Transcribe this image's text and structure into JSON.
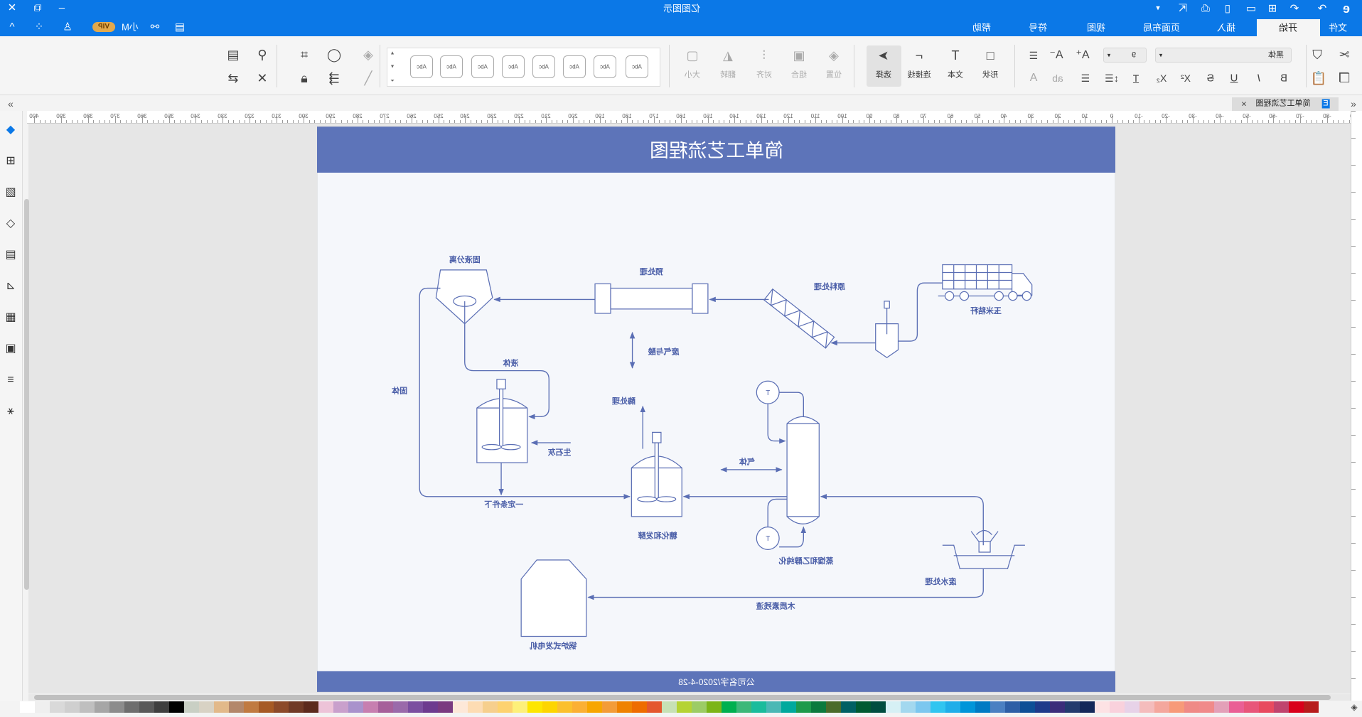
{
  "app": {
    "title": "亿图图示"
  },
  "titlebar": {
    "close_icon": "✕",
    "restore_icon": "⧉",
    "minimize_icon": "–",
    "logo_icon": "e-logo",
    "icons": [
      "redo-icon",
      "undo-icon",
      "new-icon",
      "open-icon",
      "save-icon",
      "print-icon",
      "export-icon",
      "more-icon"
    ]
  },
  "account": {
    "vip": "VIP",
    "user": "小M"
  },
  "menu_tabs": [
    {
      "label": "文件"
    },
    {
      "label": "开始"
    },
    {
      "label": "插入"
    },
    {
      "label": "页面布局"
    },
    {
      "label": "视图"
    },
    {
      "label": "符号"
    },
    {
      "label": "帮助"
    }
  ],
  "ribbon": {
    "font_name": "黑体",
    "font_size": "9",
    "tools": [
      {
        "label": "形状",
        "icon": "□"
      },
      {
        "label": "文本",
        "icon": "T"
      },
      {
        "label": "连接线",
        "icon": "⌐"
      },
      {
        "label": "选择",
        "icon": "➤"
      }
    ],
    "arrange": [
      {
        "label": "位置",
        "icon": "◈"
      },
      {
        "label": "组合",
        "icon": "▣"
      },
      {
        "label": "对齐",
        "icon": "⫶"
      },
      {
        "label": "翻转",
        "icon": "◭"
      },
      {
        "label": "大小",
        "icon": "▢"
      }
    ],
    "style_sample": "Abc"
  },
  "document_tab": {
    "title": "简单工艺流程图",
    "close": "×"
  },
  "ruler": {
    "labels": [
      400,
      390,
      380,
      370,
      360,
      350,
      340,
      330,
      320,
      310,
      300,
      290,
      280,
      270,
      260,
      250,
      240,
      230,
      220,
      210,
      200,
      190,
      180,
      170,
      160,
      150,
      140,
      130,
      120,
      110,
      100,
      90,
      80,
      70,
      60,
      50,
      40,
      30,
      20,
      10,
      0,
      -10,
      -20,
      -30,
      -40,
      -50,
      -60,
      -70,
      -80,
      -90
    ]
  },
  "diagram": {
    "title": "简单工艺流程图",
    "footer": "公司名字/2020-4-28",
    "colors": {
      "header": "#5d74b9",
      "line": "#5a6eb4",
      "text": "#4a5ea8",
      "page": "#f5f7fb"
    },
    "labels": {
      "separation": "固液分离",
      "pretreatment": "预处理",
      "raw_processing": "原料处理",
      "corn_stalk": "玉米秸秆",
      "waste_gas_acid": "废气与酸",
      "liquid": "液体",
      "solid": "固体",
      "quicklime": "生石灰",
      "conditions": "一定条件下",
      "enzyme": "酶处理",
      "saccharification": "糖化和发酵",
      "gas": "气体",
      "distillation": "蒸馏和乙醇纯化",
      "wastewater": "废水处理",
      "lignin": "木质素残渣",
      "boiler": "锅炉式发电机",
      "t1": "T",
      "t2": "T"
    }
  },
  "palette": [
    "#ffffff",
    "#efefef",
    "#d9d9d9",
    "#cfcfcf",
    "#bfbfbf",
    "#a6a6a6",
    "#8c8c8c",
    "#6e6e6e",
    "#595959",
    "#3f3f3f",
    "#000000",
    "#c9cfc4",
    "#d8d2c4",
    "#e2b98a",
    "#b3876a",
    "#c07a41",
    "#a65a25",
    "#8c4a2a",
    "#703a26",
    "#5c2a1d",
    "#edc3d8",
    "#c9a0cc",
    "#a992cc",
    "#c77fb0",
    "#a6609a",
    "#9a6aaa",
    "#7b4fa0",
    "#6d3b8f",
    "#7a3a80",
    "#fde8d8",
    "#fddcb3",
    "#f6cf8d",
    "#fdd26f",
    "#fdf07a",
    "#fde600",
    "#fdd500",
    "#fbc02d",
    "#fbb034",
    "#f7a600",
    "#f39c38",
    "#ef8200",
    "#ee6c00",
    "#e4572e",
    "#c7e1b5",
    "#b5d334",
    "#9ccc65",
    "#7cb518",
    "#00b050",
    "#3cb879",
    "#1abc9c",
    "#4ab8b5",
    "#00a99d",
    "#1d9a4b",
    "#0b7a3e",
    "#4a6b2a",
    "#006064",
    "#005a32",
    "#004d40",
    "#d6f0f5",
    "#a3d8ef",
    "#7cc7ef",
    "#30c5f0",
    "#1faee9",
    "#0095d9",
    "#007ac3",
    "#4b80c2",
    "#2e5fa6",
    "#0d4f96",
    "#1e3a8a",
    "#3b2d7a",
    "#233b6e",
    "#14285a",
    "#fde2e4",
    "#f9d1dc",
    "#e7d2e8",
    "#f4bcbc",
    "#f4a79d",
    "#f79a79",
    "#ef8a86",
    "#f08a8a",
    "#e3a0b8",
    "#ea5f95",
    "#e8567a",
    "#e84a5f",
    "#c0446e",
    "#d9001b",
    "#b71c1c"
  ]
}
